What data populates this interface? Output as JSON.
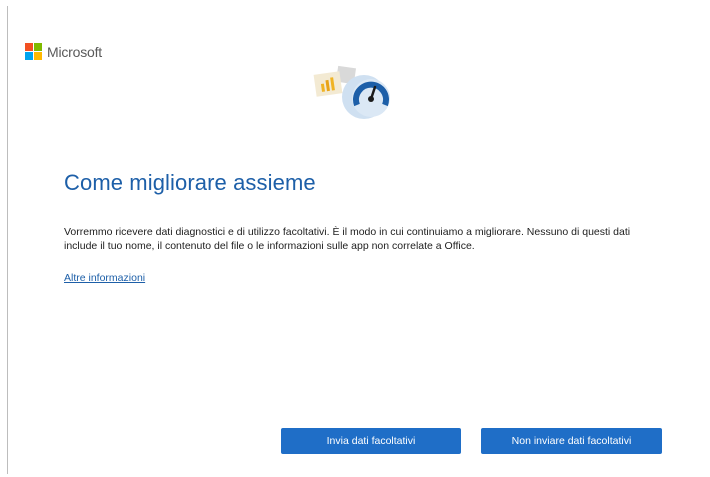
{
  "brand": {
    "name": "Microsoft",
    "logo_colors": [
      "#f25022",
      "#7fba00",
      "#00a4ef",
      "#ffb900"
    ]
  },
  "hero": {
    "icon": "diagnostics-gauge-icon",
    "accent": "#1d5fa8"
  },
  "main": {
    "title": "Come migliorare assieme",
    "description": "Vorremmo ricevere dati diagnostici e di utilizzo facoltativi. È il modo in cui continuiamo a migliorare. Nessuno di questi dati include il tuo nome, il contenuto del file o le informazioni sulle app non correlate a Office.",
    "more_link": "Altre informazioni"
  },
  "buttons": {
    "send_label": "Invia dati facoltativi",
    "no_send_label": "Non inviare dati facoltativi"
  }
}
